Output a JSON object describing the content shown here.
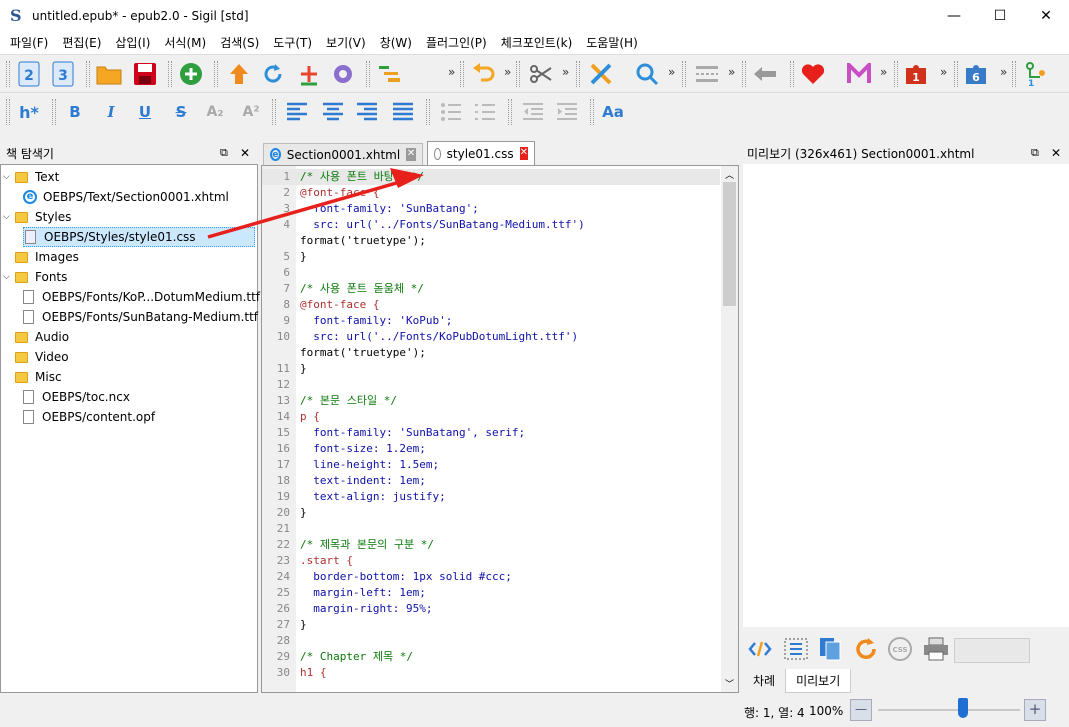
{
  "window": {
    "app_logo": "S",
    "title": "untitled.epub* - epub2.0 - Sigil [std]",
    "minimize": "—",
    "maximize": "☐",
    "close": "✕"
  },
  "menu": [
    "파일(F)",
    "편집(E)",
    "삽입(I)",
    "서식(M)",
    "검색(S)",
    "도구(T)",
    "보기(V)",
    "창(W)",
    "플러그인(P)",
    "체크포인트(k)",
    "도움말(H)"
  ],
  "toolbar2": {
    "heading": "h*",
    "bold": "B",
    "italic": "I",
    "underline": "U",
    "strike": "S",
    "subscript": "A₂",
    "superscript": "A²",
    "font_case": "Aa"
  },
  "book_browser": {
    "title": "책 탐색기",
    "items": [
      {
        "label": "Text",
        "type": "folder",
        "expanded": true
      },
      {
        "label": "OEBPS/Text/Section0001.xhtml",
        "type": "html"
      },
      {
        "label": "Styles",
        "type": "folder",
        "expanded": true
      },
      {
        "label": "OEBPS/Styles/style01.css",
        "type": "css",
        "selected": true
      },
      {
        "label": "Images",
        "type": "folder",
        "expanded": false
      },
      {
        "label": "Fonts",
        "type": "folder",
        "expanded": true
      },
      {
        "label": "OEBPS/Fonts/KoP...DotumMedium.ttf",
        "type": "font"
      },
      {
        "label": "OEBPS/Fonts/SunBatang-Medium.ttf",
        "type": "font"
      },
      {
        "label": "Audio",
        "type": "folder"
      },
      {
        "label": "Video",
        "type": "folder"
      },
      {
        "label": "Misc",
        "type": "folder"
      },
      {
        "label": "OEBPS/toc.ncx",
        "type": "file"
      },
      {
        "label": "OEBPS/content.opf",
        "type": "file"
      }
    ]
  },
  "tabs": [
    {
      "label": "Section0001.xhtml",
      "active": false
    },
    {
      "label": "style01.css",
      "active": true
    }
  ],
  "code_lines": [
    {
      "n": "1",
      "text": "/* 사용 폰트 바탕체 */",
      "kind": "comment"
    },
    {
      "n": "2",
      "text": "@font-face {",
      "kind": "at"
    },
    {
      "n": "3",
      "text": "  font-family: 'SunBatang';",
      "kind": "prop"
    },
    {
      "n": "4",
      "text": "  src: url('../Fonts/SunBatang-Medium.ttf')",
      "kind": "prop"
    },
    {
      "n": "",
      "text": "format('truetype');",
      "kind": "plain"
    },
    {
      "n": "5",
      "text": "}",
      "kind": "plain"
    },
    {
      "n": "6",
      "text": "",
      "kind": "plain"
    },
    {
      "n": "7",
      "text": "/* 사용 폰트 돋움체 */",
      "kind": "comment"
    },
    {
      "n": "8",
      "text": "@font-face {",
      "kind": "at"
    },
    {
      "n": "9",
      "text": "  font-family: 'KoPub';",
      "kind": "prop"
    },
    {
      "n": "10",
      "text": "  src: url('../Fonts/KoPubDotumLight.ttf')",
      "kind": "prop"
    },
    {
      "n": "",
      "text": "format('truetype');",
      "kind": "plain"
    },
    {
      "n": "11",
      "text": "}",
      "kind": "plain"
    },
    {
      "n": "12",
      "text": "",
      "kind": "plain"
    },
    {
      "n": "13",
      "text": "/* 본문 스타일 */",
      "kind": "comment"
    },
    {
      "n": "14",
      "text": "p {",
      "kind": "at"
    },
    {
      "n": "15",
      "text": "  font-family: 'SunBatang', serif;",
      "kind": "prop"
    },
    {
      "n": "16",
      "text": "  font-size: 1.2em;",
      "kind": "prop"
    },
    {
      "n": "17",
      "text": "  line-height: 1.5em;",
      "kind": "prop"
    },
    {
      "n": "18",
      "text": "  text-indent: 1em;",
      "kind": "prop"
    },
    {
      "n": "19",
      "text": "  text-align: justify;",
      "kind": "prop"
    },
    {
      "n": "20",
      "text": "}",
      "kind": "plain"
    },
    {
      "n": "21",
      "text": "",
      "kind": "plain"
    },
    {
      "n": "22",
      "text": "/* 제목과 본문의 구분 */",
      "kind": "comment"
    },
    {
      "n": "23",
      "text": ".start {",
      "kind": "at"
    },
    {
      "n": "24",
      "text": "  border-bottom: 1px solid #ccc;",
      "kind": "prop"
    },
    {
      "n": "25",
      "text": "  margin-left: 1em;",
      "kind": "prop"
    },
    {
      "n": "26",
      "text": "  margin-right: 95%;",
      "kind": "prop"
    },
    {
      "n": "27",
      "text": "}",
      "kind": "plain"
    },
    {
      "n": "28",
      "text": "",
      "kind": "plain"
    },
    {
      "n": "29",
      "text": "/* Chapter 제목 */",
      "kind": "comment"
    },
    {
      "n": "30",
      "text": "h1 {",
      "kind": "at"
    }
  ],
  "preview": {
    "title": "미리보기 (326x461) Section0001.xhtml",
    "css_label": "CSS"
  },
  "bottom_tabs": [
    {
      "label": "차례",
      "active": false
    },
    {
      "label": "미리보기",
      "active": true
    }
  ],
  "status": {
    "position": "행: 1, 열: 4",
    "zoom": "100%",
    "zoom_minus": "—",
    "zoom_plus": "+",
    "zoom_level": 0.6
  },
  "colors": {
    "accent_red": "#e8201c",
    "selection": "#cce8ff",
    "comment": "#0a7a0a"
  }
}
